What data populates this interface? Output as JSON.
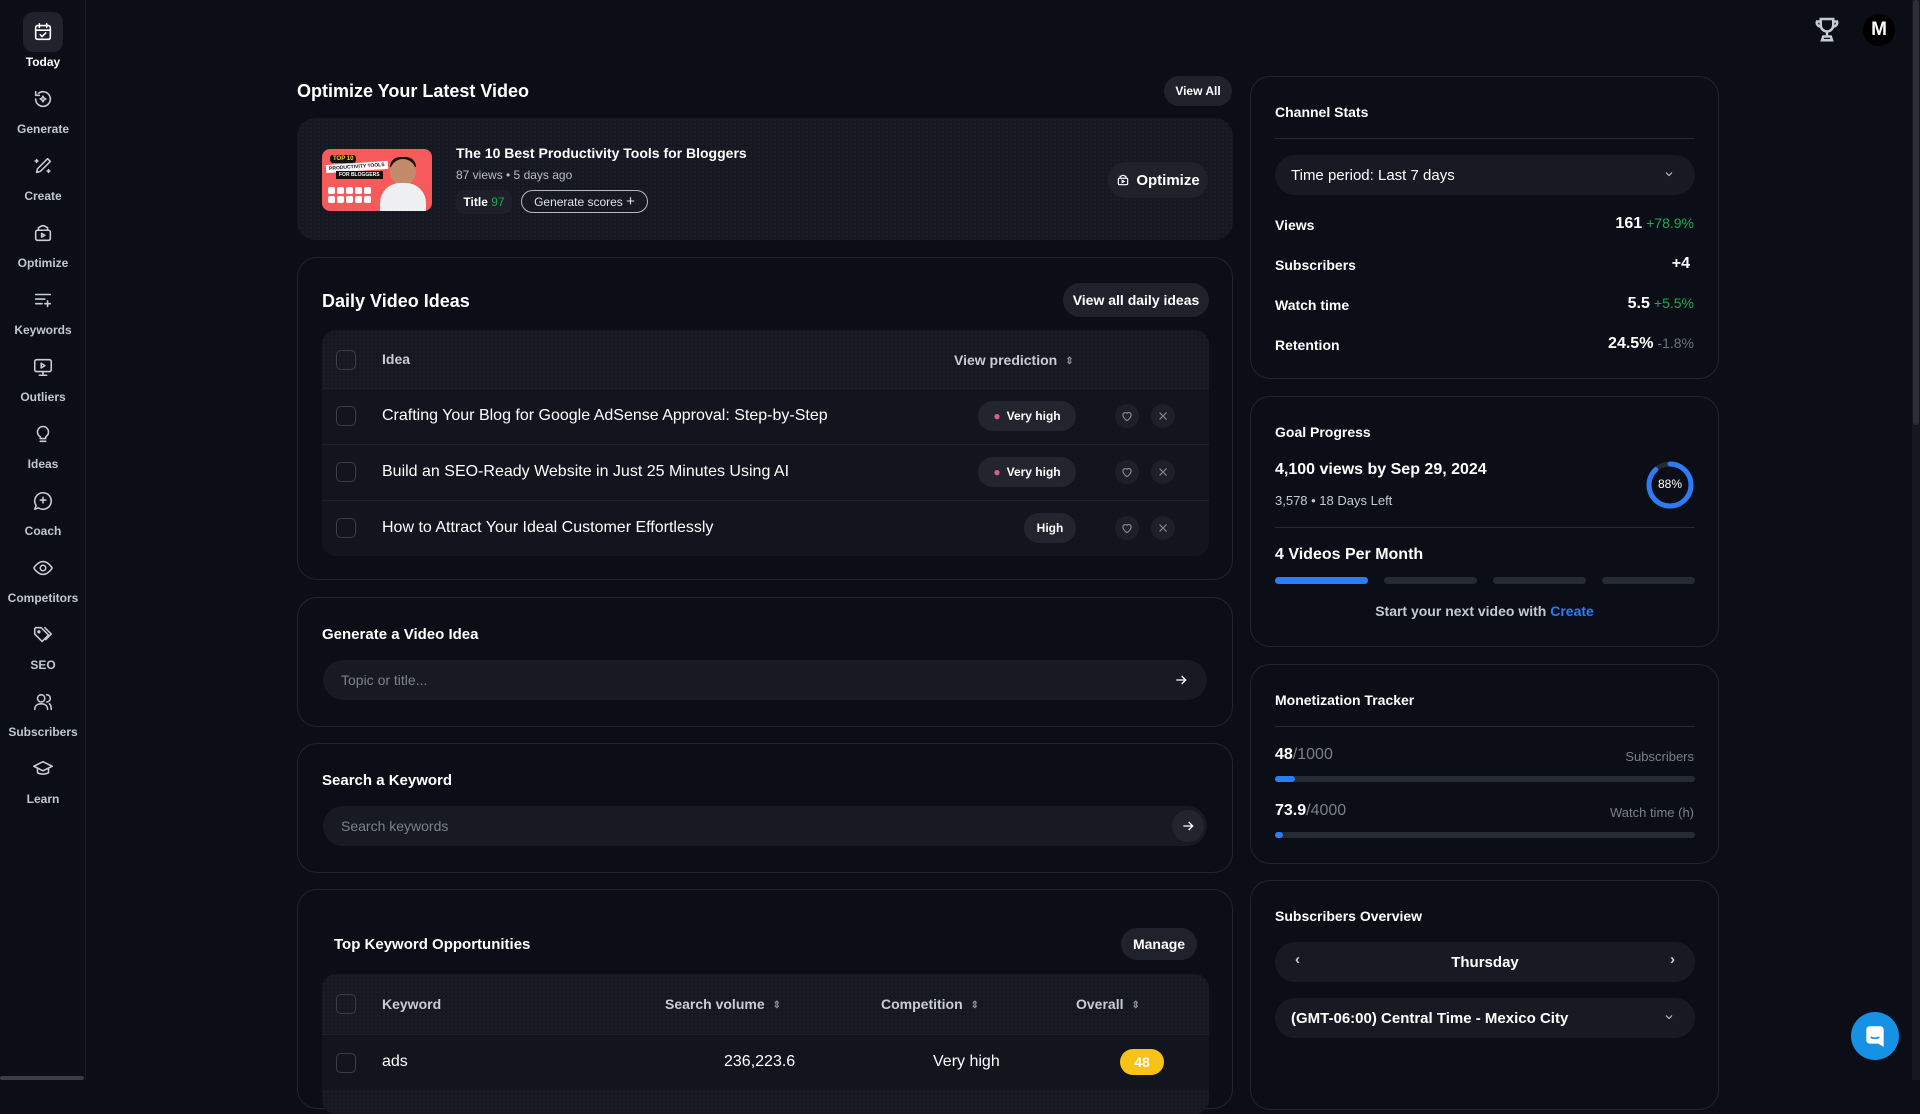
{
  "sidebar": {
    "items": [
      {
        "label": "Today",
        "icon": "calendar-check-icon",
        "active": true
      },
      {
        "label": "Generate",
        "icon": "sparkle-refresh-icon"
      },
      {
        "label": "Create",
        "icon": "pencil-sparkle-icon"
      },
      {
        "label": "Optimize",
        "icon": "video-box-icon"
      },
      {
        "label": "Keywords",
        "icon": "list-sparkle-icon"
      },
      {
        "label": "Outliers",
        "icon": "monitor-play-icon"
      },
      {
        "label": "Ideas",
        "icon": "lightbulb-icon"
      },
      {
        "label": "Coach",
        "icon": "chat-sparkle-icon"
      },
      {
        "label": "Competitors",
        "icon": "eye-icon"
      },
      {
        "label": "SEO",
        "icon": "tags-icon"
      },
      {
        "label": "Subscribers",
        "icon": "users-icon"
      },
      {
        "label": "Learn",
        "icon": "graduation-cap-icon"
      }
    ]
  },
  "topbar": {
    "avatar_letter": "M"
  },
  "latest_video": {
    "heading": "Optimize Your Latest Video",
    "view_all": "View All",
    "title": "The 10 Best Productivity Tools for Bloggers",
    "meta": "87 views • 5 days ago",
    "title_score_label": "Title",
    "title_score": "97",
    "generate_scores": "Generate scores",
    "optimize": "Optimize",
    "thumbnail_text": [
      "TOP 10",
      "PRODUCTIVITY TOOLS",
      "FOR BLOGGERS"
    ]
  },
  "daily_ideas": {
    "heading": "Daily Video Ideas",
    "view_all": "View all daily ideas",
    "col_idea": "Idea",
    "col_prediction": "View prediction",
    "rows": [
      {
        "idea": "Crafting Your Blog for Google AdSense Approval: Step-by-Step",
        "prediction": "Very high",
        "hot": true
      },
      {
        "idea": "Build an SEO-Ready Website in Just 25 Minutes Using AI",
        "prediction": "Very high",
        "hot": true
      },
      {
        "idea": "How to Attract Your Ideal Customer Effortlessly",
        "prediction": "High",
        "hot": false
      }
    ]
  },
  "generate_idea": {
    "heading": "Generate a Video Idea",
    "placeholder": "Topic or title..."
  },
  "search_keyword": {
    "heading": "Search a Keyword",
    "placeholder": "Search keywords"
  },
  "keyword_opps": {
    "heading": "Top Keyword Opportunities",
    "manage": "Manage",
    "cols": [
      "Keyword",
      "Search volume",
      "Competition",
      "Overall"
    ],
    "rows": [
      {
        "keyword": "ads",
        "volume": "236,223.6",
        "competition": "Very high",
        "overall": "48"
      }
    ]
  },
  "channel_stats": {
    "heading": "Channel Stats",
    "period": "Time period: Last 7 days",
    "stats": [
      {
        "label": "Views",
        "value": "161",
        "change": "+78.9%",
        "trend": "up"
      },
      {
        "label": "Subscribers",
        "value": "+4",
        "change": "",
        "trend": ""
      },
      {
        "label": "Watch time",
        "value": "5.5",
        "change": "+5.5%",
        "trend": "up"
      },
      {
        "label": "Retention",
        "value": "24.5%",
        "change": "-1.8%",
        "trend": "down"
      }
    ]
  },
  "goal": {
    "heading": "Goal Progress",
    "target": "4,100 views by Sep 29, 2024",
    "progress_text": "3,578 • 18 Days Left",
    "percent_label": "88%",
    "percent": 88,
    "videos_heading": "4 Videos Per Month",
    "videos_done": 1,
    "videos_total": 4,
    "cta_prefix": "Start your next video with",
    "cta_link": "Create"
  },
  "monetization": {
    "heading": "Monetization Tracker",
    "subs_value": "48",
    "subs_goal": "/1000",
    "subs_label": "Subscribers",
    "subs_fraction": 0.048,
    "watch_value": "73.9",
    "watch_goal": "/4000",
    "watch_label": "Watch time (h)",
    "watch_fraction": 0.018
  },
  "subs_overview": {
    "heading": "Subscribers Overview",
    "day": "Thursday",
    "timezone": "(GMT-06:00) Central Time - Mexico City"
  },
  "colors": {
    "accent": "#2d7cf6",
    "positive": "#1ea952",
    "score_badge": "#f7c315",
    "chat": "#1691e3"
  }
}
